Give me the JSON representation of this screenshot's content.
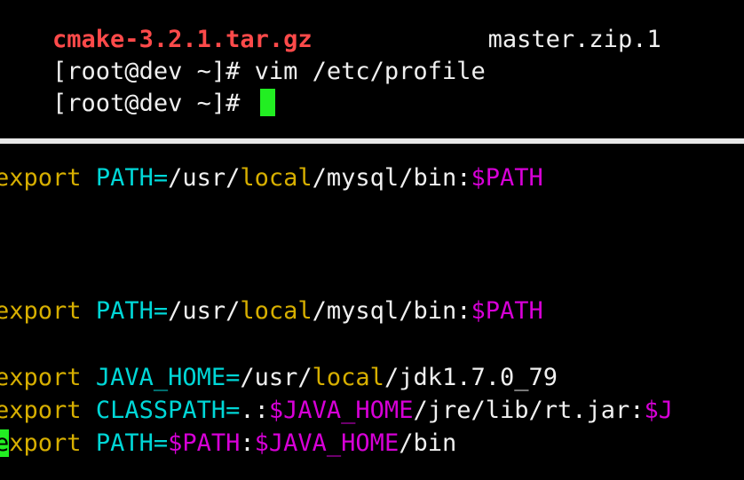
{
  "shell": {
    "listing": {
      "file_left": "cmake-3.2.1.tar.gz",
      "file_right": "master.zip.1",
      "file_left_color": "#ff4a4a"
    },
    "prompt": "[root@dev ~]# ",
    "command": "vim /etc/profile",
    "cursor_color": "#22ee22"
  },
  "editor": {
    "colors": {
      "keyword": "#d7af00",
      "variable": "#00d7d7",
      "local": "#d7af00",
      "expansion": "#d700d7",
      "default": "#f0f0f0"
    },
    "lines": [
      [
        {
          "text": "export",
          "type": "keyword"
        },
        {
          "text": " ",
          "type": "default"
        },
        {
          "text": "PATH=",
          "type": "variable"
        },
        {
          "text": "/usr/",
          "type": "default"
        },
        {
          "text": "local",
          "type": "local"
        },
        {
          "text": "/mysql/bin:",
          "type": "default"
        },
        {
          "text": "$PATH",
          "type": "expansion"
        }
      ],
      [
        {
          "text": "export",
          "type": "keyword"
        },
        {
          "text": " ",
          "type": "default"
        },
        {
          "text": "PATH=",
          "type": "variable"
        },
        {
          "text": "/usr/",
          "type": "default"
        },
        {
          "text": "local",
          "type": "local"
        },
        {
          "text": "/mysql/bin:",
          "type": "default"
        },
        {
          "text": "$PATH",
          "type": "expansion"
        }
      ],
      [
        {
          "text": "export",
          "type": "keyword"
        },
        {
          "text": " ",
          "type": "default"
        },
        {
          "text": "JAVA_HOME=",
          "type": "variable"
        },
        {
          "text": "/usr/",
          "type": "default"
        },
        {
          "text": "local",
          "type": "local"
        },
        {
          "text": "/jdk1.7.0_79",
          "type": "default"
        }
      ],
      [
        {
          "text": "export",
          "type": "keyword"
        },
        {
          "text": " ",
          "type": "default"
        },
        {
          "text": "CLASSPATH=",
          "type": "variable"
        },
        {
          "text": ".:",
          "type": "default"
        },
        {
          "text": "$JAVA_HOME",
          "type": "expansion"
        },
        {
          "text": "/jre/lib/rt.jar:",
          "type": "default"
        },
        {
          "text": "$J",
          "type": "expansion"
        }
      ],
      [
        {
          "text": "e",
          "type": "cursor"
        },
        {
          "text": "xport",
          "type": "keyword"
        },
        {
          "text": " ",
          "type": "default"
        },
        {
          "text": "PATH=",
          "type": "variable"
        },
        {
          "text": "$PATH",
          "type": "expansion"
        },
        {
          "text": ":",
          "type": "default"
        },
        {
          "text": "$JAVA_HOME",
          "type": "expansion"
        },
        {
          "text": "/bin",
          "type": "default"
        }
      ]
    ]
  }
}
